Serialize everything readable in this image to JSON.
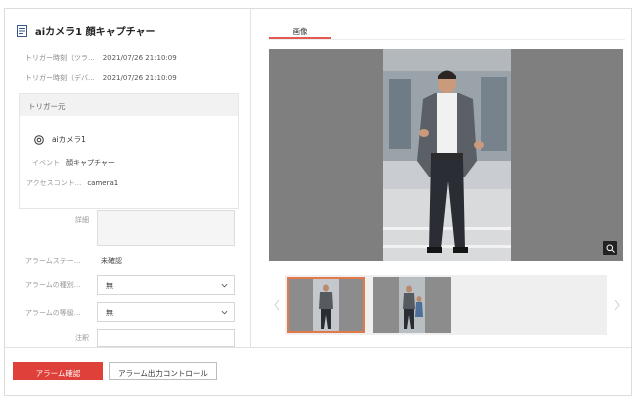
{
  "title": "aiカメラ1 顔キャプチャー",
  "title_icon": "document-icon",
  "trigger_time_1": {
    "label": "トリガー時刻（ツラ...",
    "value": "2021/07/26 21:10:09"
  },
  "trigger_time_2": {
    "label": "トリガー時刻（デバ...",
    "value": "2021/07/26 21:10:09"
  },
  "trigger_source": {
    "header": "トリガー元",
    "camera_name": "aiカメラ1",
    "event_label": "イベント",
    "event_value": "顔キャプチャー",
    "access_label": "アクセスコント...",
    "access_value": "camera1"
  },
  "remark_label": "詳細",
  "alarm_status": {
    "label": "アラームステー...",
    "value": "未確認"
  },
  "alarm_type": {
    "label": "アラームの種別...",
    "value": "無"
  },
  "alarm_level": {
    "label": "アラームの等級...",
    "value": "無"
  },
  "note_label": "注釈",
  "media_tab": "画像",
  "buttons": {
    "confirm": "アラーム確認",
    "output_control": "アラーム出力コントロール"
  },
  "colors": {
    "accent": "#e0403a",
    "selected_thumb": "#e07a4b"
  }
}
